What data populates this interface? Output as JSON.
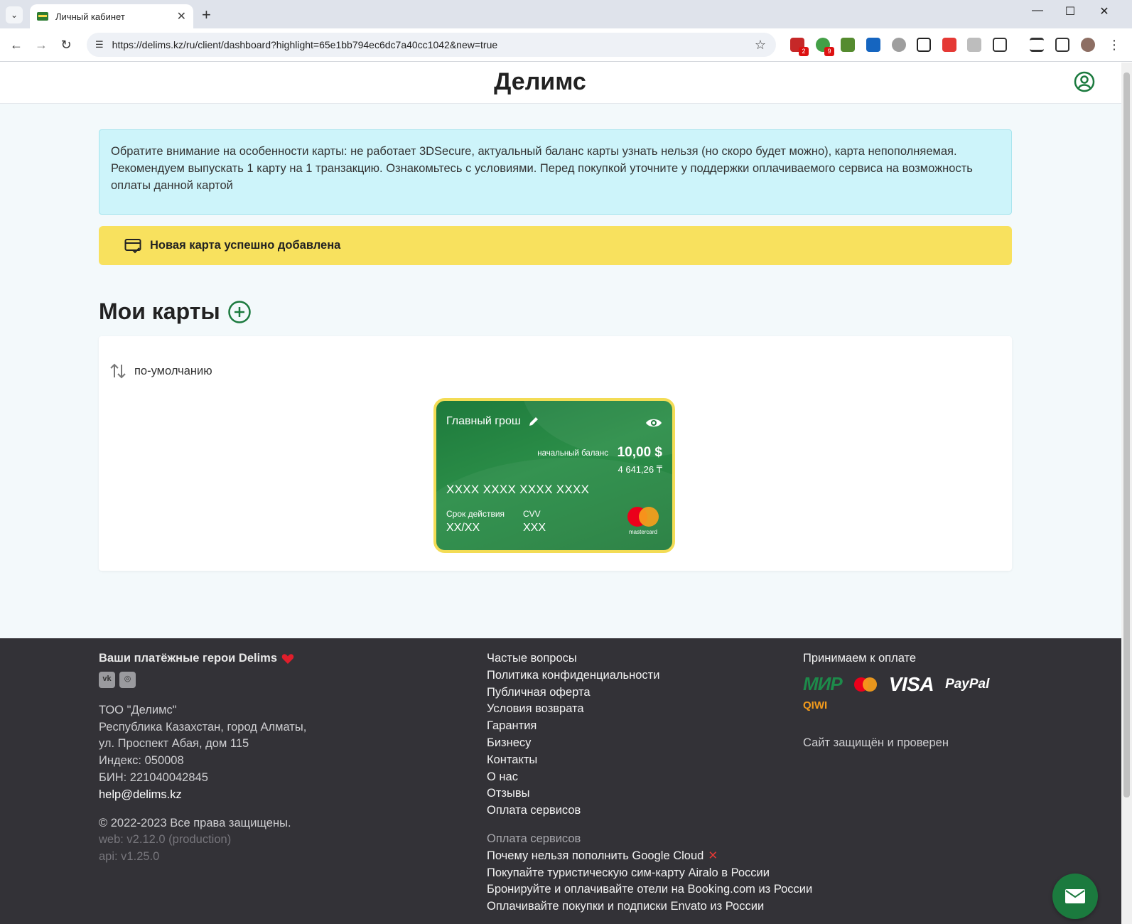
{
  "browser": {
    "tab_title": "Личный кабинет",
    "url": "https://delims.kz/ru/client/dashboard?highlight=65e1bb794ec6dc7a40cc1042&new=true",
    "ext_badges": [
      "2",
      "9"
    ]
  },
  "header": {
    "logo": "Делимс"
  },
  "notice": {
    "text": "Обратите внимание на особенности карты: не работает 3DSecure, актуальный баланс карты узнать нельзя (но скоро будет можно), карта непополняемая. Рекомендуем выпускать 1 карту на 1 транзакцию. Ознакомьтесь с условиями. Перед покупкой уточните у поддержки оплачиваемого сервиса на возможность оплаты данной картой"
  },
  "success": {
    "text": "Новая карта успешно добавлена"
  },
  "cards": {
    "title": "Мои карты",
    "sort_label": "по-умолчанию",
    "card": {
      "name": "Главный грош",
      "balance_label": "начальный баланс",
      "balance_usd": "10,00 $",
      "balance_kzt": "4 641,26 ₸",
      "number": "XXXX XXXX XXXX XXXX",
      "expiry_label": "Срок действия",
      "expiry_value": "XX/XX",
      "cvv_label": "CVV",
      "cvv_value": "XXX",
      "brand": "mastercard"
    }
  },
  "footer": {
    "heroes": "Ваши платёжные герои Delims",
    "company": "ТОО \"Делимс\"",
    "address1": "Республика Казахстан, город Алматы,",
    "address2": "ул. Проспект Абая, дом 115",
    "index": "Индекс: 050008",
    "bin": "БИН: 221040042845",
    "email": "help@delims.kz",
    "copyright": "© 2022-2023 Все права защищены.",
    "web_version": "web: v2.12.0 (production)",
    "api_version": "api: v1.25.0",
    "links": [
      "Частые вопросы",
      "Политика конфиденциальности",
      "Публичная оферта",
      "Условия возврата",
      "Гарантия",
      "Бизнесу",
      "Контакты",
      "О нас",
      "Отзывы",
      "Оплата сервисов"
    ],
    "services_heading": "Оплата сервисов",
    "service_links": [
      "Почему нельзя пополнить Google Cloud",
      "Покупайте туристическую сим-карту Airalo в России",
      "Бронируйте и оплачивайте отели на Booking.com из России",
      "Оплачивайте покупки и подписки Envato из России"
    ],
    "payment_heading": "Принимаем к оплате",
    "payment_methods": [
      "МИР",
      "VISA",
      "PayPal",
      "QIWI"
    ],
    "secured": "Сайт защищён и проверен"
  },
  "colors": {
    "brand_green": "#1b7a3e",
    "notice_bg": "#cdf4fa",
    "success_bg": "#f8e15e",
    "footer_bg": "#333237"
  }
}
